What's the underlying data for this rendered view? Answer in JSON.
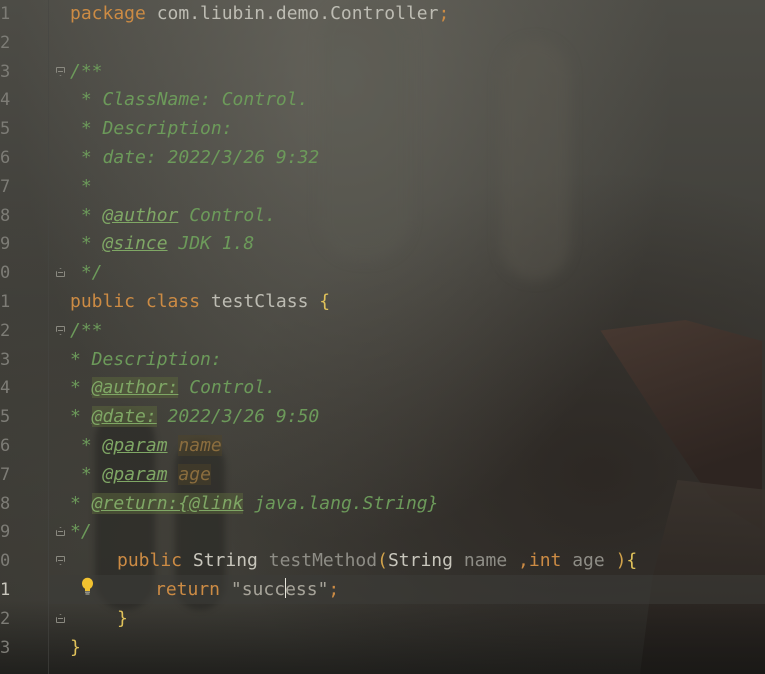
{
  "line_numbers": [
    "1",
    "2",
    "3",
    "4",
    "5",
    "6",
    "7",
    "8",
    "9",
    "0",
    "1",
    "2",
    "3",
    "4",
    "5",
    "6",
    "7",
    "8",
    "9",
    "0",
    "1",
    "2",
    "3"
  ],
  "active_line_index": 20,
  "code": {
    "l1": {
      "kw": "package",
      "pkg": " com.liubin.demo.Controller",
      "semi": ";"
    },
    "l3": {
      "c": "/**"
    },
    "l4": {
      "c": " * ClassName: Control."
    },
    "l5": {
      "c": " * Description:"
    },
    "l6": {
      "c": " * date: 2022/3/26 9:32"
    },
    "l7": {
      "c": " *"
    },
    "l8": {
      "pre": " * ",
      "tag": "@author",
      "post": " Control."
    },
    "l9": {
      "pre": " * ",
      "tag": "@since",
      "post": " JDK 1.8"
    },
    "l10": {
      "c": " */"
    },
    "l11": {
      "kw1": "public",
      "kw2": " class",
      "name": " testClass ",
      "brace": "{"
    },
    "l12": {
      "c": "/**"
    },
    "l13": {
      "c": "* Description:"
    },
    "l14": {
      "pre": "* ",
      "tag": "@author:",
      "post": " Control."
    },
    "l15": {
      "pre": "* ",
      "tag": "@date:",
      "post": " 2022/3/26 9:50"
    },
    "l16": {
      "pre": " * ",
      "tag": "@param",
      "sp": " ",
      "param": "name"
    },
    "l17": {
      "pre": " * ",
      "tag": "@param",
      "sp": " ",
      "param": "age"
    },
    "l18": {
      "pre": "* ",
      "tag": "@return:{@link",
      "post": " java.lang.String}"
    },
    "l19": {
      "c": "*/"
    },
    "l20": {
      "kw": "public",
      "type1": " String",
      "method": " testMethod",
      "p1": "(",
      "type2": "String",
      "n1": " name ",
      "comma": ",",
      "kw2": "int",
      "n2": " age ",
      "p2": ")",
      "brace": "{"
    },
    "l21": {
      "kw": "return",
      "str1": " \"succ",
      "str2": "ess\"",
      "semi": ";"
    },
    "l22": {
      "brace": "}"
    },
    "l23": {
      "brace": "}"
    }
  },
  "icons": {
    "bulb": "lightbulb-icon",
    "fold": "fold-marker-icon"
  },
  "colors": {
    "keyword": "#cc8b44",
    "comment": "#6c9a5a",
    "tag": "#7fa765",
    "param": "#8b6d3e",
    "text": "#bdbcb3"
  }
}
